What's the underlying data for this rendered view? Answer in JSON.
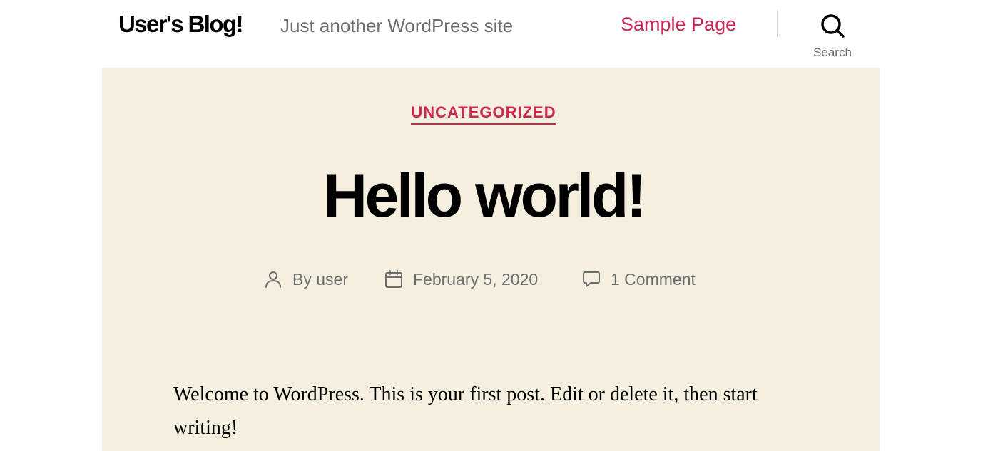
{
  "header": {
    "site_title": "User's Blog!",
    "site_description": "Just another WordPress site",
    "nav": [
      {
        "label": "Sample Page"
      }
    ],
    "search_label": "Search"
  },
  "post": {
    "category": "UNCATEGORIZED",
    "title": "Hello world!",
    "meta": {
      "author": "By user",
      "date": "February 5, 2020",
      "comments": "1 Comment"
    },
    "content": "Welcome to WordPress. This is your first post. Edit or delete it, then start writing!"
  },
  "colors": {
    "accent": "#cd2653",
    "header_bg": "#f5efe0",
    "secondary_text": "#6d6d6d"
  },
  "icons": {
    "search": "search-icon",
    "author": "user-icon",
    "date": "calendar-icon",
    "comments": "comment-icon"
  }
}
